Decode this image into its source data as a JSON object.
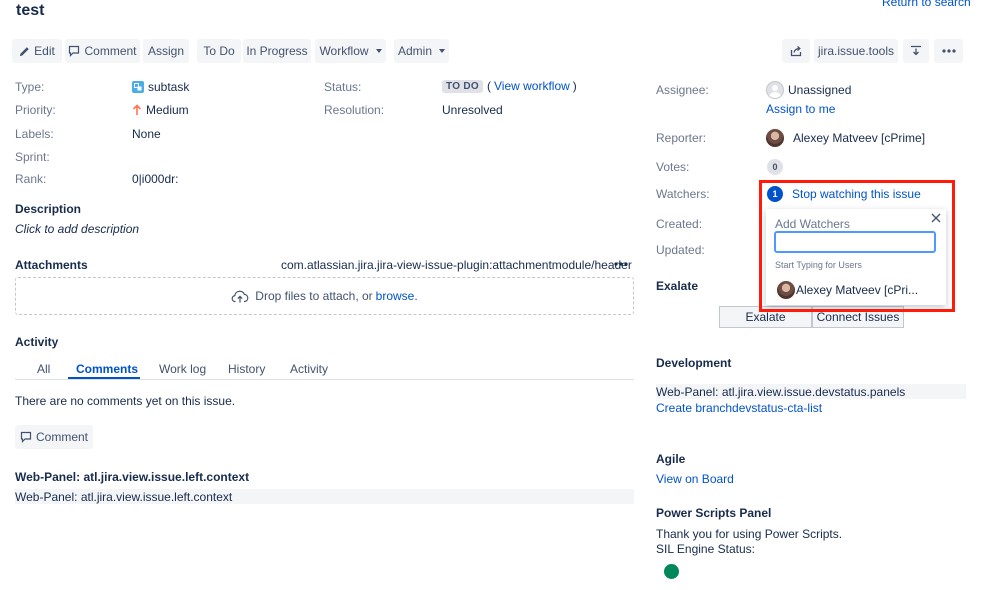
{
  "colors": {
    "link": "#0052cc",
    "highlight": "#ff1a0a",
    "status_dot": "#00875a",
    "watch_badge": "#0052cc"
  },
  "issue": {
    "title": "test"
  },
  "nav": {
    "return_to_search": "Return to search"
  },
  "toolbar": {
    "edit": "Edit",
    "comment": "Comment",
    "assign": "Assign",
    "todo": "To Do",
    "in_progress": "In Progress",
    "workflow": "Workflow",
    "admin": "Admin",
    "tools_label": "jira.issue.tools"
  },
  "details": {
    "type_label": "Type:",
    "type_value": "subtask",
    "priority_label": "Priority:",
    "priority_value": "Medium",
    "labels_label": "Labels:",
    "labels_value": "None",
    "sprint_label": "Sprint:",
    "rank_label": "Rank:",
    "rank_value": "0|i000dr:",
    "status_label": "Status:",
    "status_value": "TO DO",
    "view_workflow_open": "(",
    "view_workflow": "View workflow",
    "view_workflow_close": ")",
    "resolution_label": "Resolution:",
    "resolution_value": "Unresolved"
  },
  "description": {
    "heading": "Description",
    "placeholder": "Click to add description"
  },
  "attachments": {
    "heading": "Attachments",
    "header_key": "com.atlassian.jira.jira-view-issue-plugin:attachmentmodule/header",
    "drop_text": "Drop files to attach, or",
    "browse": "browse."
  },
  "activity": {
    "heading": "Activity",
    "tabs": [
      "All",
      "Comments",
      "Work log",
      "History",
      "Activity"
    ],
    "active_tab": "Comments",
    "empty_text": "There are no comments yet on this issue.",
    "comment_button": "Comment"
  },
  "left_panel": {
    "heading": "Web-Panel: atl.jira.view.issue.left.context",
    "content": "Web-Panel: atl.jira.view.issue.left.context"
  },
  "people": {
    "assignee_label": "Assignee:",
    "assignee_value": "Unassigned",
    "assign_to_me": "Assign to me",
    "reporter_label": "Reporter:",
    "reporter_value": "Alexey Matveev [cPrime]",
    "votes_label": "Votes:",
    "votes_count": "0",
    "watchers_label": "Watchers:",
    "watchers_count": "1",
    "stop_watching": "Stop watching this issue"
  },
  "dates": {
    "created_label": "Created:",
    "updated_label": "Updated:"
  },
  "watchers_popup": {
    "title": "Add Watchers",
    "input_value": "",
    "hint": "Start Typing for Users",
    "user": "Alexey Matveev [cPri..."
  },
  "exalate": {
    "heading": "Exalate",
    "exalate_button": "Exalate",
    "connect_button": "Connect Issues"
  },
  "development": {
    "heading": "Development",
    "panel": "Web-Panel: atl.jira.view.issue.devstatus.panels",
    "create_branch": "Create branchdevstatus-cta-list"
  },
  "agile": {
    "heading": "Agile",
    "view_on_board": "View on Board"
  },
  "power_scripts": {
    "heading": "Power Scripts Panel",
    "thanks": "Thank you for using Power Scripts.",
    "engine_status": "SIL Engine Status:"
  }
}
